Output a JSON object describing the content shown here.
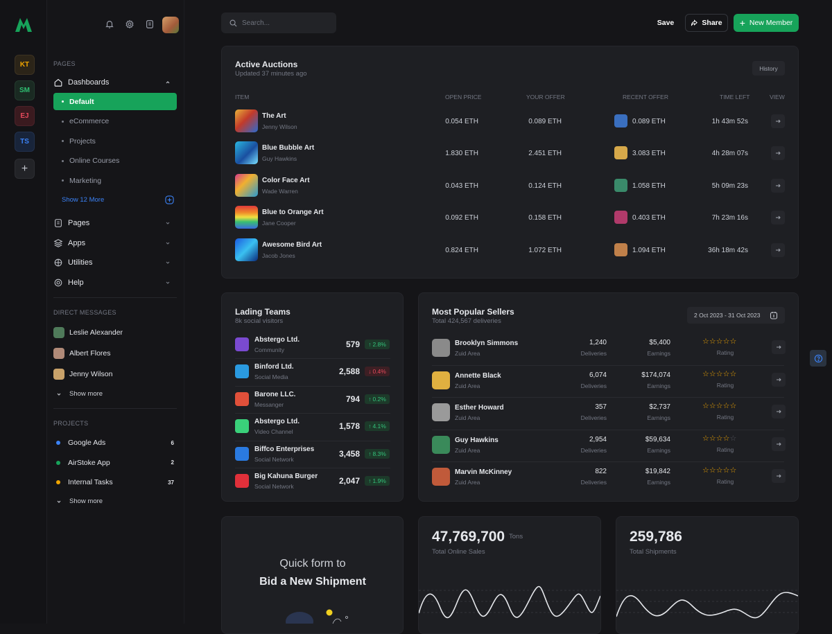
{
  "rail": {
    "workspaces": [
      {
        "initials": "KT",
        "bg": "#2b2418",
        "fg": "#f0a500",
        "border": "#3d3322"
      },
      {
        "initials": "SM",
        "bg": "#1a2a22",
        "fg": "#2fbf71",
        "border": "#243a2e"
      },
      {
        "initials": "EJ",
        "bg": "#3a1a1f",
        "fg": "#e5495c",
        "border": "#4a2229"
      },
      {
        "initials": "TS",
        "bg": "#18243a",
        "fg": "#3b82f6",
        "border": "#22314d"
      }
    ],
    "add_label": "+"
  },
  "sidebar": {
    "pages_heading": "PAGES",
    "dashboards_label": "Dashboards",
    "dashboard_items": [
      "Default",
      "eCommerce",
      "Projects",
      "Online Courses",
      "Marketing"
    ],
    "show_more_label": "Show 12 More",
    "menu": [
      "Pages",
      "Apps",
      "Utilities",
      "Help"
    ],
    "dm_heading": "DIRECT MESSAGES",
    "messages": [
      {
        "name": "Leslie Alexander",
        "color": "#4f7a5a"
      },
      {
        "name": "Albert Flores",
        "color": "#b08a78"
      },
      {
        "name": "Jenny Wilson",
        "color": "#c9a26a"
      }
    ],
    "dm_show_more": "Show more",
    "projects_heading": "PROJECTS",
    "projects": [
      {
        "name": "Google Ads",
        "count": "6",
        "color": "#3b82f6"
      },
      {
        "name": "AirStoke App",
        "count": "2",
        "color": "#17a35a"
      },
      {
        "name": "Internal Tasks",
        "count": "37",
        "color": "#f0a500"
      }
    ],
    "projects_show_more": "Show more"
  },
  "header": {
    "search_placeholder": "Search...",
    "save_label": "Save",
    "share_label": "Share",
    "new_member_label": "New Member"
  },
  "auctions": {
    "title": "Active Auctions",
    "subtitle": "Updated 37 minutes ago",
    "history_label": "History",
    "columns": [
      "ITEM",
      "OPEN PRICE",
      "YOUR OFFER",
      "RECENT OFFER",
      "TIME LEFT",
      "VIEW"
    ],
    "rows": [
      {
        "name": "The Art",
        "author": "Jenny Wilson",
        "open": "0.054 ETH",
        "offer": "0.089 ETH",
        "recent": "0.089 ETH",
        "time": "1h 43m 52s",
        "thumb": "linear-gradient(135deg,#e8b23a,#c23a2a 45%,#2a6ad0)",
        "av": "#3a6fbf"
      },
      {
        "name": "Blue Bubble Art",
        "author": "Guy Hawkins",
        "open": "1.830 ETH",
        "offer": "2.451 ETH",
        "recent": "3.083 ETH",
        "time": "4h 28m 07s",
        "thumb": "linear-gradient(135deg,#2ab6e0,#1a4fa0 55%,#7ae0ff)",
        "av": "#d6a84a"
      },
      {
        "name": "Color Face Art",
        "author": "Wade Warren",
        "open": "0.043 ETH",
        "offer": "0.124 ETH",
        "recent": "1.058 ETH",
        "time": "5h 09m 23s",
        "thumb": "linear-gradient(135deg,#d43a8a,#f0b030 40%,#2a9ad0)",
        "av": "#3a8a6a"
      },
      {
        "name": "Blue to Orange Art",
        "author": "Jane Cooper",
        "open": "0.092 ETH",
        "offer": "0.158 ETH",
        "recent": "0.403 ETH",
        "time": "7h 23m 16s",
        "thumb": "linear-gradient(180deg,#e03a3a,#f08a2a 30%,#f0e040 50%,#3ac070 70%,#3a6ae0)",
        "av": "#b03a6a"
      },
      {
        "name": "Awesome Bird Art",
        "author": "Jacob Jones",
        "open": "0.824 ETH",
        "offer": "1.072 ETH",
        "recent": "1.094 ETH",
        "time": "36h 18m 42s",
        "thumb": "linear-gradient(135deg,#1a5ae0,#3ac0f0 50%,#0a2a7a)",
        "av": "#c0804a"
      }
    ]
  },
  "teams": {
    "title": "Lading Teams",
    "subtitle": "8k social visitors",
    "rows": [
      {
        "name": "Abstergo Ltd.",
        "type": "Community",
        "value": "579",
        "change": "2.8%",
        "dir": "up",
        "logo": "#7a4ad0"
      },
      {
        "name": "Binford Ltd.",
        "type": "Social Media",
        "value": "2,588",
        "change": "0.4%",
        "dir": "down",
        "logo": "#2a9ae0"
      },
      {
        "name": "Barone LLC.",
        "type": "Messanger",
        "value": "794",
        "change": "0.2%",
        "dir": "up",
        "logo": "#e0503a"
      },
      {
        "name": "Abstergo Ltd.",
        "type": "Video Channel",
        "value": "1,578",
        "change": "4.1%",
        "dir": "up",
        "logo": "#3ad07a"
      },
      {
        "name": "Biffco Enterprises",
        "type": "Social Network",
        "value": "3,458",
        "change": "8.3%",
        "dir": "up",
        "logo": "#2a7ae0"
      },
      {
        "name": "Big Kahuna Burger",
        "type": "Social Network",
        "value": "2,047",
        "change": "1.9%",
        "dir": "up",
        "logo": "#e0303a"
      }
    ]
  },
  "sellers": {
    "title": "Most Popular Sellers",
    "subtitle": "Total 424,567 deliveries",
    "date_range": "2 Oct 2023 - 31 Oct 2023",
    "deliveries_label": "Deliveries",
    "earnings_label": "Earnings",
    "rating_label": "Rating",
    "rows": [
      {
        "name": "Brooklyn Simmons",
        "area": "Zuid Area",
        "deliveries": "1,240",
        "earnings": "$5,400",
        "rating": 5,
        "av": "#8a8a8a"
      },
      {
        "name": "Annette Black",
        "area": "Zuid Area",
        "deliveries": "6,074",
        "earnings": "$174,074",
        "rating": 5,
        "av": "#e0b040"
      },
      {
        "name": "Esther Howard",
        "area": "Zuid Area",
        "deliveries": "357",
        "earnings": "$2,737",
        "rating": 5,
        "av": "#9a9a9a"
      },
      {
        "name": "Guy Hawkins",
        "area": "Zuid Area",
        "deliveries": "2,954",
        "earnings": "$59,634",
        "rating": 4,
        "av": "#3a8a5a"
      },
      {
        "name": "Marvin McKinney",
        "area": "Zuid Area",
        "deliveries": "822",
        "earnings": "$19,842",
        "rating": 5,
        "av": "#c05a3a"
      }
    ]
  },
  "quick_form": {
    "line1": "Quick form to",
    "line2": "Bid a New Shipment"
  },
  "online_sales": {
    "value": "47,769,700",
    "unit": "Tons",
    "label": "Total Online Sales"
  },
  "shipments": {
    "value": "259,786",
    "label": "Total Shipments"
  },
  "colors": {
    "accent": "#17a35a",
    "bg": "#151518",
    "card": "#1e1f23",
    "up": "#34c07a",
    "down": "#e5495c",
    "star": "#f0a500"
  }
}
